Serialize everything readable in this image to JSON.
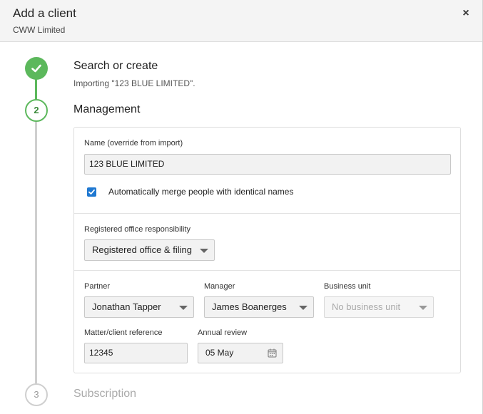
{
  "header": {
    "title": "Add a client",
    "subtitle": "CWW Limited",
    "close_label": "×"
  },
  "steps": [
    {
      "number": "1",
      "title": "Search or create",
      "subtitle": "Importing \"123 BLUE LIMITED\".",
      "status": "complete"
    },
    {
      "number": "2",
      "title": "Management",
      "status": "active"
    },
    {
      "number": "3",
      "title": "Subscription",
      "status": "pending"
    }
  ],
  "form": {
    "name_label": "Name (override from import)",
    "name_value": "123 BLUE LIMITED",
    "merge_label": "Automatically merge people with identical names",
    "merge_checked": true,
    "registered_office_label": "Registered office responsibility",
    "registered_office_value": "Registered office & filing",
    "partner_label": "Partner",
    "partner_value": "Jonathan Tapper",
    "manager_label": "Manager",
    "manager_value": "James Boanerges",
    "business_unit_label": "Business unit",
    "business_unit_value": "No business unit",
    "reference_label": "Matter/client reference",
    "reference_value": "12345",
    "annual_review_label": "Annual review",
    "annual_review_value": "05 May"
  },
  "colors": {
    "complete": "#5cb85c",
    "checkbox": "#1f78d1",
    "pending": "#cfcfcf"
  }
}
